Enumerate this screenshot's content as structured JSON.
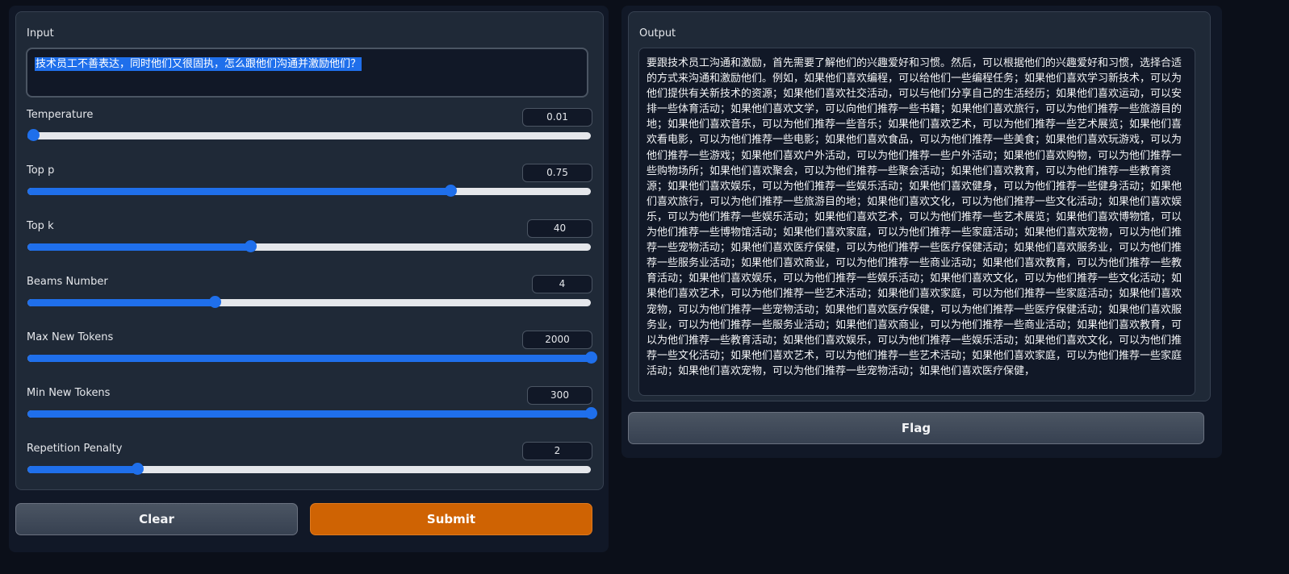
{
  "input": {
    "label": "Input",
    "value": "技术员工不善表达，同时他们又很固执，怎么跟他们沟通并激励他们？"
  },
  "sliders": [
    {
      "key": "temperature",
      "label": "Temperature",
      "value": "0.01",
      "fraction": 0.01
    },
    {
      "key": "top_p",
      "label": "Top p",
      "value": "0.75",
      "fraction": 0.75
    },
    {
      "key": "top_k",
      "label": "Top k",
      "value": "40",
      "fraction": 0.395
    },
    {
      "key": "beams",
      "label": "Beams Number",
      "value": "4",
      "fraction": 0.333
    },
    {
      "key": "max_new_tokens",
      "label": "Max New Tokens",
      "value": "2000",
      "fraction": 1.0
    },
    {
      "key": "min_new_tokens",
      "label": "Min New Tokens",
      "value": "300",
      "fraction": 1.0
    },
    {
      "key": "repetition_penalty",
      "label": "Repetition Penalty",
      "value": "2",
      "fraction": 0.195
    }
  ],
  "buttons": {
    "clear": "Clear",
    "submit": "Submit",
    "flag": "Flag"
  },
  "output": {
    "label": "Output",
    "text": "要跟技术员工沟通和激励，首先需要了解他们的兴趣爱好和习惯。然后，可以根据他们的兴趣爱好和习惯，选择合适的方式来沟通和激励他们。例如，如果他们喜欢编程，可以给他们一些编程任务；如果他们喜欢学习新技术，可以为他们提供有关新技术的资源；如果他们喜欢社交活动，可以与他们分享自己的生活经历；如果他们喜欢运动，可以安排一些体育活动；如果他们喜欢文学，可以向他们推荐一些书籍；如果他们喜欢旅行，可以为他们推荐一些旅游目的地；如果他们喜欢音乐，可以为他们推荐一些音乐；如果他们喜欢艺术，可以为他们推荐一些艺术展览；如果他们喜欢看电影，可以为他们推荐一些电影；如果他们喜欢食品，可以为他们推荐一些美食；如果他们喜欢玩游戏，可以为他们推荐一些游戏；如果他们喜欢户外活动，可以为他们推荐一些户外活动；如果他们喜欢购物，可以为他们推荐一些购物场所；如果他们喜欢聚会，可以为他们推荐一些聚会活动；如果他们喜欢教育，可以为他们推荐一些教育资源；如果他们喜欢娱乐，可以为他们推荐一些娱乐活动；如果他们喜欢健身，可以为他们推荐一些健身活动；如果他们喜欢旅行，可以为他们推荐一些旅游目的地；如果他们喜欢文化，可以为他们推荐一些文化活动；如果他们喜欢娱乐，可以为他们推荐一些娱乐活动；如果他们喜欢艺术，可以为他们推荐一些艺术展览；如果他们喜欢博物馆，可以为他们推荐一些博物馆活动；如果他们喜欢家庭，可以为他们推荐一些家庭活动；如果他们喜欢宠物，可以为他们推荐一些宠物活动；如果他们喜欢医疗保健，可以为他们推荐一些医疗保健活动；如果他们喜欢服务业，可以为他们推荐一些服务业活动；如果他们喜欢商业，可以为他们推荐一些商业活动；如果他们喜欢教育，可以为他们推荐一些教育活动；如果他们喜欢娱乐，可以为他们推荐一些娱乐活动；如果他们喜欢文化，可以为他们推荐一些文化活动；如果他们喜欢艺术，可以为他们推荐一些艺术活动；如果他们喜欢家庭，可以为他们推荐一些家庭活动；如果他们喜欢宠物，可以为他们推荐一些宠物活动；如果他们喜欢医疗保健，可以为他们推荐一些医疗保健活动；如果他们喜欢服务业，可以为他们推荐一些服务业活动；如果他们喜欢商业，可以为他们推荐一些商业活动；如果他们喜欢教育，可以为他们推荐一些教育活动；如果他们喜欢娱乐，可以为他们推荐一些娱乐活动；如果他们喜欢文化，可以为他们推荐一些文化活动；如果他们喜欢艺术，可以为他们推荐一些艺术活动；如果他们喜欢家庭，可以为他们推荐一些家庭活动；如果他们喜欢宠物，可以为他们推荐一些宠物活动；如果他们喜欢医疗保健，"
  },
  "colors": {
    "accent": "#1f6feb",
    "submit": "#cf6303",
    "panel": "#1f2937",
    "background": "#0b0f19"
  }
}
